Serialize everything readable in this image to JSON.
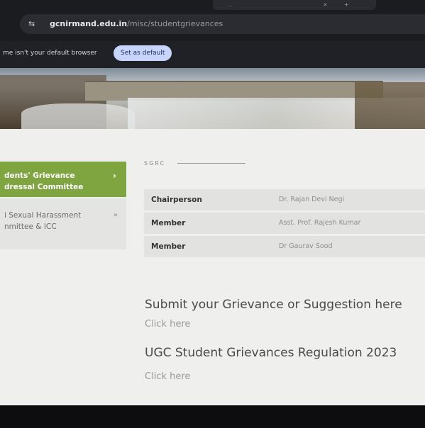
{
  "browser": {
    "tab": {
      "title": "...",
      "close": "×",
      "new_tab": "+"
    },
    "url_host": "gcnirmand.edu.in",
    "url_path": "/misc/studentgrievances",
    "infobar_text": "me isn't your default browser",
    "default_button": "Set as default"
  },
  "sidebar": {
    "items": [
      {
        "line1": "dents' Grievance",
        "line2": "dressal Committee",
        "active": true
      },
      {
        "line1": "i Sexual Harassment",
        "line2": "nmittee & ICC",
        "active": false
      }
    ]
  },
  "section": {
    "label": "SGRC"
  },
  "members": [
    {
      "role": "Chairperson",
      "name": "Dr. Rajan Devi Negi"
    },
    {
      "role": "Member",
      "name": "Asst. Prof. Rajesh Kumar"
    },
    {
      "role": "Member",
      "name": "Dr Gaurav Sood"
    }
  ],
  "cta": [
    {
      "title": "Submit your Grievance or Suggestion here",
      "link": "Click here"
    },
    {
      "title": "UGC Student Grievances Regulation 2023",
      "link": "Click here"
    }
  ],
  "colors": {
    "accent": "#7fa541",
    "page_bg": "#efefed"
  },
  "icons": {
    "site_settings": "tune-icon",
    "chevron": "chevron-right-icon"
  }
}
